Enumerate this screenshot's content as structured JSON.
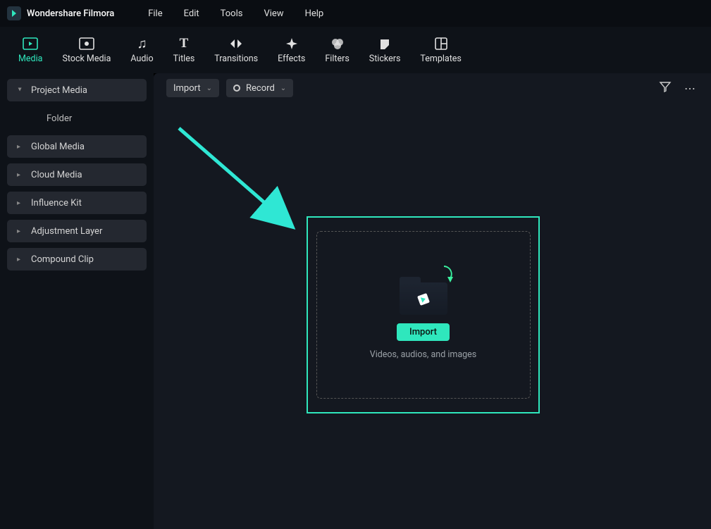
{
  "app": {
    "title": "Wondershare Filmora"
  },
  "menubar": {
    "items": [
      "File",
      "Edit",
      "Tools",
      "View",
      "Help"
    ]
  },
  "ribbon": {
    "tabs": [
      {
        "label": "Media",
        "active": true
      },
      {
        "label": "Stock Media"
      },
      {
        "label": "Audio"
      },
      {
        "label": "Titles"
      },
      {
        "label": "Transitions"
      },
      {
        "label": "Effects"
      },
      {
        "label": "Filters"
      },
      {
        "label": "Stickers"
      },
      {
        "label": "Templates"
      }
    ]
  },
  "sidebar": {
    "items": {
      "project_media": "Project Media",
      "folder": "Folder",
      "global_media": "Global Media",
      "cloud_media": "Cloud Media",
      "influence_kit": "Influence Kit",
      "adjustment_layer": "Adjustment Layer",
      "compound_clip": "Compound Clip"
    }
  },
  "toolbar": {
    "import_label": "Import",
    "record_label": "Record"
  },
  "dropzone": {
    "button": "Import",
    "hint": "Videos, audios, and images"
  },
  "colors": {
    "accent": "#2fe7bd"
  }
}
